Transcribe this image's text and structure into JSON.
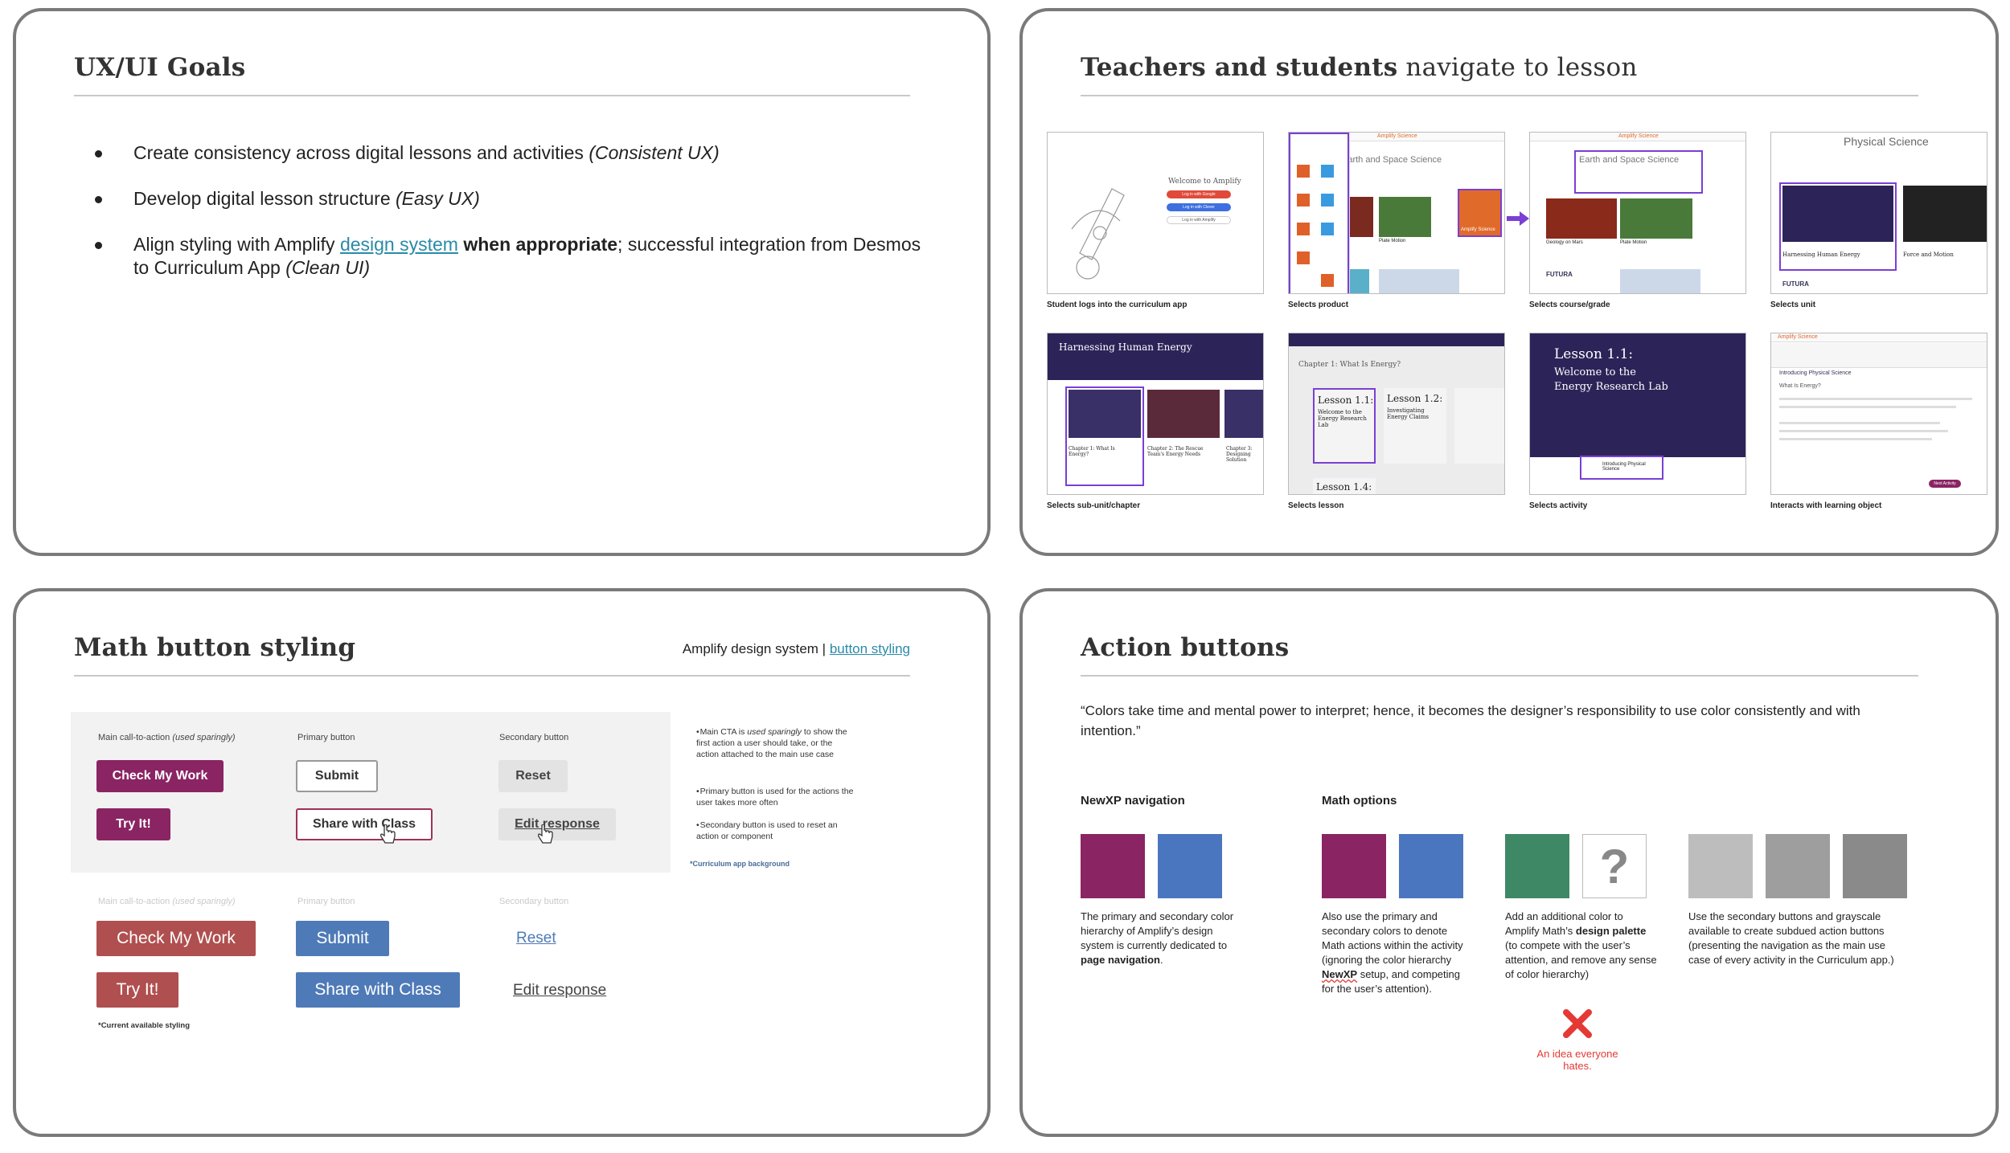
{
  "slide1": {
    "title": "UX/UI Goals",
    "bullets": [
      {
        "text": "Create consistency across digital lessons and activities ",
        "italic": "(Consistent UX)"
      },
      {
        "text": "Develop digital lesson structure ",
        "italic": "(Easy UX)"
      },
      {
        "pre": "Align styling with Amplify ",
        "link": "design system",
        "bold": " when appropriate",
        "post": "; successful integration from Desmos to Curriculum App ",
        "italic": "(Clean UI)"
      }
    ]
  },
  "slide2": {
    "title_bold": "Teachers and students",
    "title_light": " navigate to lesson",
    "captions": [
      "Student logs into the curriculum app",
      "Selects product",
      "Selects course/grade",
      "Selects unit",
      "Selects sub-unit/chapter",
      "Selects lesson",
      "Selects activity",
      "Interacts with learning object"
    ],
    "thumb_text": {
      "welcome": "Welcome to Amplify",
      "login_google": "Log in with Google",
      "login_clever": "Log in with Clever",
      "login_amplify": "Log in with Amplify",
      "brand": "Amplify Science",
      "earth_space": "Earth and Space Science",
      "plate_motion": "Plate Motion",
      "geology_mars": "Geology on Mars",
      "physical_science": "Physical Science",
      "harnessing": "Harnessing Human Energy",
      "force_motion": "Force and Motion",
      "futura": "FUTURA",
      "chapter1": "Chapter 1: What Is Energy?",
      "chapter2": "Chapter 2: The Rescue Team's Energy Needs",
      "chapter3": "Chapter 3: Designing Solution",
      "lesson11": "Lesson 1.1:",
      "lesson11_sub": "Welcome to the Energy Research Lab",
      "lesson12": "Lesson 1.2:",
      "lesson12_sub": "Investigating Energy Claims",
      "lesson14": "Lesson 1.4:",
      "lesson11_big": "Lesson 1.1:",
      "lesson11_big_sub": "Welcome to the Energy Research Lab",
      "intro_phys": "Introducing Physical Science",
      "what_energy": "What Is Energy?",
      "next_activity": "Next Activity"
    }
  },
  "slide3": {
    "title": "Math button styling",
    "ref_text": "Amplify design system | ",
    "ref_link": "button styling",
    "hdr_cta": "Main call-to-action ",
    "hdr_cta_italic": "(used sparingly)",
    "hdr_primary": "Primary button",
    "hdr_secondary": "Secondary button",
    "btn_check": "Check My Work",
    "btn_try": "Try It!",
    "btn_submit": "Submit",
    "btn_share": "Share with Class",
    "btn_reset": "Reset",
    "btn_edit": "Edit response",
    "notes": [
      {
        "pre": "Main CTA is ",
        "italic": "used sparingly",
        "post": " to show the first action a user should take, or the action attached to the main use case"
      },
      {
        "pre": "Primary button is used for the actions the user takes more often",
        "italic": "",
        "post": ""
      },
      {
        "pre": "Secondary button is used to reset an action or component",
        "italic": "",
        "post": ""
      }
    ],
    "bg_note": "*Curriculum app background",
    "current_note": "*Current available styling"
  },
  "slide4": {
    "title": "Action buttons",
    "quote": "“Colors take time and mental power to interpret; hence, it becomes the designer’s responsibility to use color consistently and with intention.”",
    "label_nav": "NewXP navigation",
    "label_math": "Math options",
    "desc1_pre": "The primary and secondary color hierarchy of Amplify’s design system is currently dedicated to ",
    "desc1_bold": "page navigation",
    "desc1_post": ".",
    "desc2_pre": "Also use the primary and secondary colors to denote Math actions within the activity (ignoring the color hierarchy ",
    "desc2_bold": "NewXP",
    "desc2_post": " setup, and competing for the user’s attention).",
    "desc3_pre": "Add an additional color to Amplify Math’s ",
    "desc3_bold": "design palette",
    "desc3_post": " (to compete with the user’s attention, and remove any sense of color hierarchy)",
    "desc4": "Use the secondary buttons and grayscale available to create subdued action buttons (presenting the navigation as the main use case of every activity in the Curriculum app.)",
    "question_mark": "?",
    "bad_idea": "An idea everyone hates.",
    "colors": {
      "magenta": "#8a2463",
      "blue": "#4a76c0",
      "green": "#3f8866",
      "gray1": "#bdbdbd",
      "gray2": "#9e9e9e",
      "gray3": "#8a8a8a",
      "red": "#e53935"
    }
  }
}
